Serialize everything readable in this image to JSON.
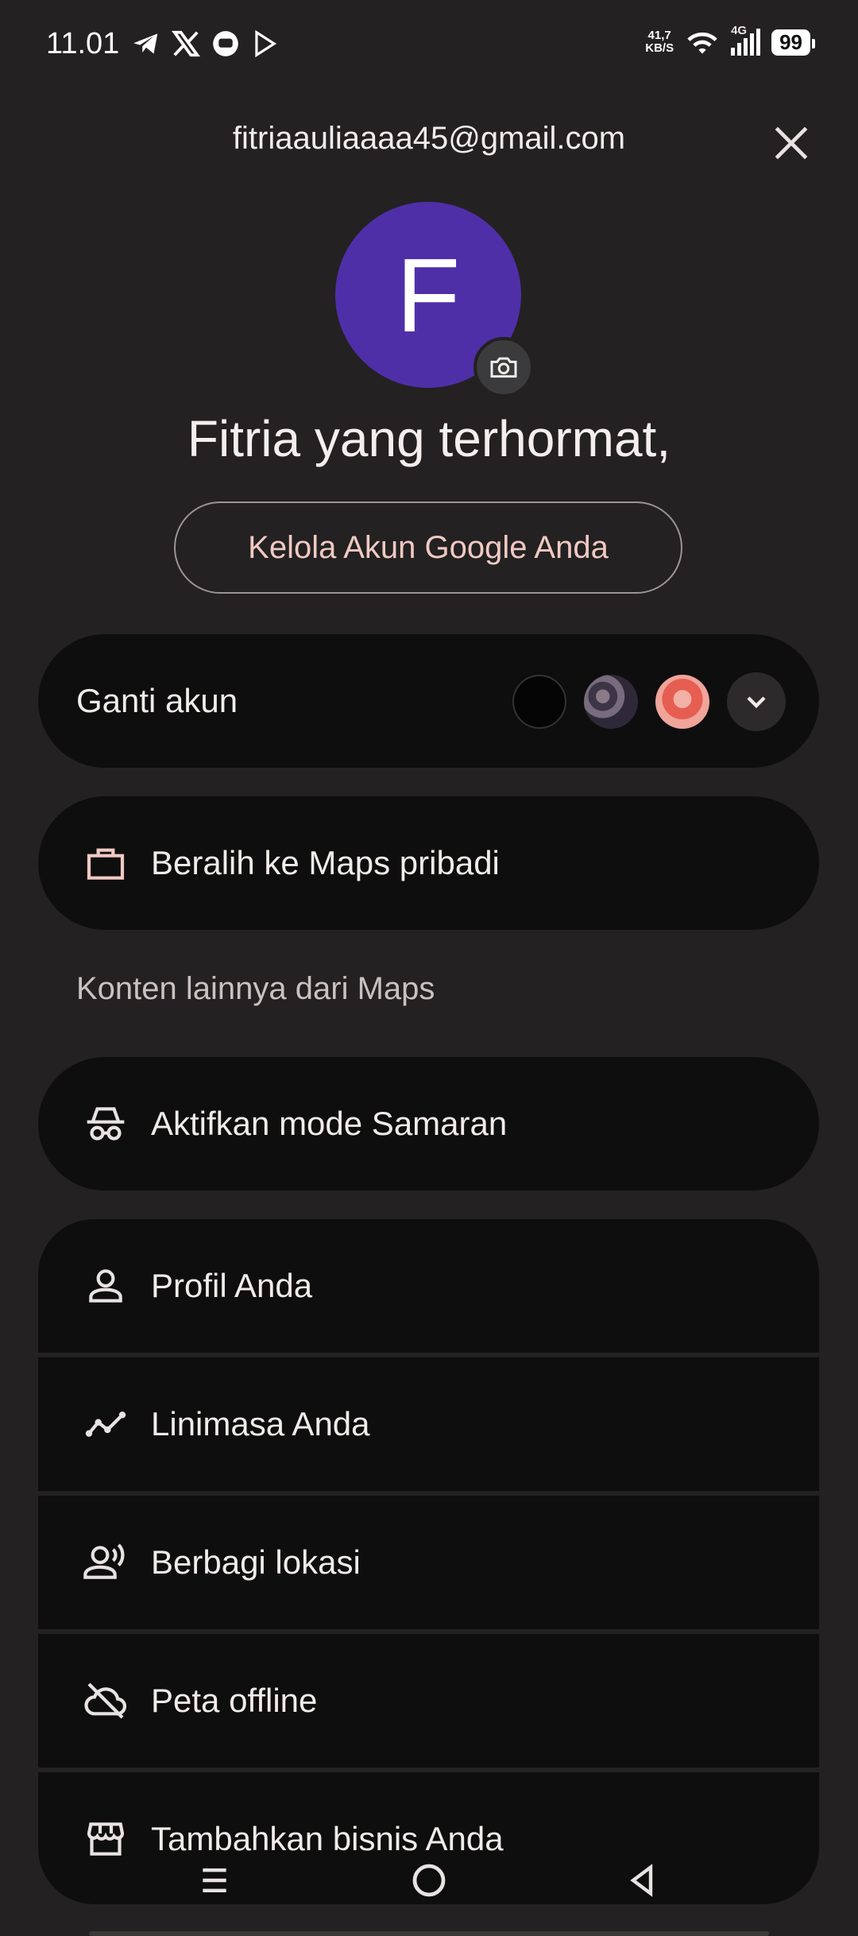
{
  "status": {
    "time": "11.01",
    "net_speed_value": "41,7",
    "net_speed_unit": "KB/S",
    "network": "4G",
    "battery": "99",
    "app_icons": [
      "telegram-icon",
      "x-icon",
      "chat-icon",
      "play-icon"
    ]
  },
  "header": {
    "email": "fitriaauliaaaa45@gmail.com"
  },
  "profile": {
    "initial": "F",
    "greeting": "Fitria yang terhormat,",
    "manage_button": "Kelola Akun Google Anda",
    "avatar_color": "#4f2fa8"
  },
  "switch_account": {
    "label": "Ganti akun"
  },
  "work_mode": {
    "label": "Beralih ke Maps pribadi"
  },
  "section_title": "Konten lainnya dari Maps",
  "incognito": {
    "label": "Aktifkan mode Samaran"
  },
  "menu": [
    {
      "label": "Profil Anda",
      "icon": "person-icon"
    },
    {
      "label": "Linimasa Anda",
      "icon": "timeline-icon"
    },
    {
      "label": "Berbagi lokasi",
      "icon": "share-location-icon"
    },
    {
      "label": "Peta offline",
      "icon": "offline-map-icon"
    },
    {
      "label": "Tambahkan bisnis Anda",
      "icon": "storefront-icon"
    }
  ],
  "colors": {
    "background": "#232121",
    "card": "#0f0e0e",
    "accent_text": "#f0c9c3"
  }
}
